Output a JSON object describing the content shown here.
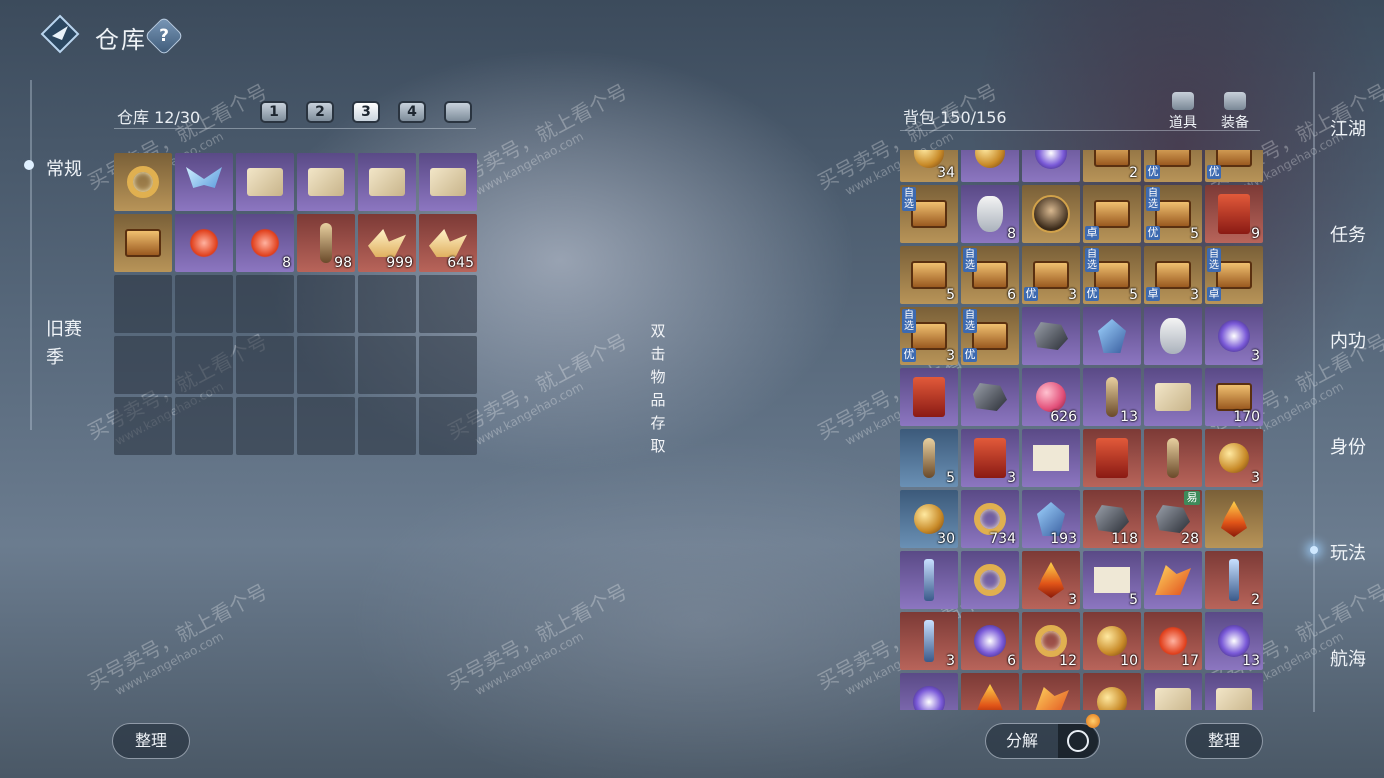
{
  "header": {
    "title": "仓库",
    "help_label": "?"
  },
  "left_nav": {
    "regular": "常规",
    "old_season": "旧赛季"
  },
  "warehouse": {
    "label": "仓库",
    "capacity": "12/30",
    "pages": [
      "1",
      "2",
      "3",
      "4",
      ""
    ],
    "active_page": "3",
    "items": [
      {
        "rarity": "gold",
        "icon": "ring",
        "count": ""
      },
      {
        "rarity": "purple",
        "icon": "butterfly",
        "count": ""
      },
      {
        "rarity": "purple",
        "icon": "scroll",
        "count": ""
      },
      {
        "rarity": "purple",
        "icon": "scroll",
        "count": ""
      },
      {
        "rarity": "purple",
        "icon": "scroll",
        "count": ""
      },
      {
        "rarity": "purple",
        "icon": "scroll",
        "count": ""
      },
      {
        "rarity": "gold",
        "icon": "box",
        "count": ""
      },
      {
        "rarity": "purple",
        "icon": "flower",
        "count": ""
      },
      {
        "rarity": "purple",
        "icon": "flower",
        "count": "8"
      },
      {
        "rarity": "red",
        "icon": "feather",
        "count": "98"
      },
      {
        "rarity": "red",
        "icon": "bird",
        "count": "999"
      },
      {
        "rarity": "red",
        "icon": "bird",
        "count": "645"
      },
      {},
      {},
      {},
      {},
      {},
      {},
      {},
      {},
      {},
      {},
      {},
      {},
      {},
      {},
      {},
      {},
      {},
      {}
    ]
  },
  "hint": "双击物品存取",
  "backpack": {
    "label": "背包",
    "capacity": "150/156",
    "tabs": [
      "道具",
      "装备"
    ],
    "items": [
      {
        "rarity": "gold",
        "icon": "orb",
        "count": "34"
      },
      {
        "rarity": "purple",
        "icon": "orb",
        "count": ""
      },
      {
        "rarity": "purple",
        "icon": "sigil",
        "count": ""
      },
      {
        "rarity": "gold",
        "icon": "box",
        "count": "2"
      },
      {
        "rarity": "gold",
        "icon": "box",
        "count": "",
        "tag2": "优"
      },
      {
        "rarity": "gold",
        "icon": "box",
        "count": "",
        "tag2": "优"
      },
      {
        "rarity": "gold",
        "icon": "box",
        "count": "",
        "tag": "自选"
      },
      {
        "rarity": "purple",
        "icon": "bottle",
        "count": "8"
      },
      {
        "rarity": "gold",
        "icon": "portrait",
        "count": ""
      },
      {
        "rarity": "gold",
        "icon": "box",
        "count": "",
        "tag2": "卓"
      },
      {
        "rarity": "gold",
        "icon": "box",
        "count": "5",
        "tag": "自选",
        "tag2": "优"
      },
      {
        "rarity": "red",
        "icon": "card",
        "count": "9"
      },
      {
        "rarity": "gold",
        "icon": "box",
        "count": "5"
      },
      {
        "rarity": "gold",
        "icon": "box",
        "count": "6",
        "tag": "自选"
      },
      {
        "rarity": "gold",
        "icon": "box",
        "count": "3",
        "tag2": "优"
      },
      {
        "rarity": "gold",
        "icon": "box",
        "count": "5",
        "tag": "自选",
        "tag2": "优"
      },
      {
        "rarity": "gold",
        "icon": "box",
        "count": "3",
        "tag2": "卓"
      },
      {
        "rarity": "gold",
        "icon": "box",
        "count": "",
        "tag": "自选",
        "tag2": "卓"
      },
      {
        "rarity": "gold",
        "icon": "box",
        "count": "3",
        "tag": "自选",
        "tag2": "优"
      },
      {
        "rarity": "gold",
        "icon": "box",
        "count": "",
        "tag": "自选",
        "tag2": "优"
      },
      {
        "rarity": "purple",
        "icon": "rock",
        "count": ""
      },
      {
        "rarity": "purple",
        "icon": "crystal",
        "count": ""
      },
      {
        "rarity": "purple",
        "icon": "bottle",
        "count": ""
      },
      {
        "rarity": "purple",
        "icon": "sigil",
        "count": "3"
      },
      {
        "rarity": "purple",
        "icon": "card",
        "count": ""
      },
      {
        "rarity": "purple",
        "icon": "rock",
        "count": ""
      },
      {
        "rarity": "purple",
        "icon": "pink",
        "count": "626"
      },
      {
        "rarity": "purple",
        "icon": "feather",
        "count": "13"
      },
      {
        "rarity": "purple",
        "icon": "scroll",
        "count": ""
      },
      {
        "rarity": "purple",
        "icon": "box",
        "count": "170"
      },
      {
        "rarity": "blue",
        "icon": "feather",
        "count": "5"
      },
      {
        "rarity": "purple",
        "icon": "card",
        "count": "3"
      },
      {
        "rarity": "purple",
        "icon": "paper",
        "count": ""
      },
      {
        "rarity": "red",
        "icon": "card",
        "count": ""
      },
      {
        "rarity": "red",
        "icon": "feather",
        "count": ""
      },
      {
        "rarity": "red",
        "icon": "orb",
        "count": "3"
      },
      {
        "rarity": "blue",
        "icon": "orb",
        "count": "30"
      },
      {
        "rarity": "purple",
        "icon": "ring",
        "count": "734"
      },
      {
        "rarity": "purple",
        "icon": "crystal",
        "count": "193"
      },
      {
        "rarity": "red",
        "icon": "rock",
        "count": "118"
      },
      {
        "rarity": "red",
        "icon": "rock",
        "count": "28",
        "tagr": "易"
      },
      {
        "rarity": "gold",
        "icon": "flame",
        "count": ""
      },
      {
        "rarity": "purple",
        "icon": "blade",
        "count": ""
      },
      {
        "rarity": "purple",
        "icon": "ring",
        "count": ""
      },
      {
        "rarity": "red",
        "icon": "flame",
        "count": "3"
      },
      {
        "rarity": "purple",
        "icon": "paper",
        "count": "5"
      },
      {
        "rarity": "purple",
        "icon": "wing",
        "count": ""
      },
      {
        "rarity": "red",
        "icon": "blade",
        "count": "2"
      },
      {
        "rarity": "red",
        "icon": "blade",
        "count": "3"
      },
      {
        "rarity": "red",
        "icon": "sigil",
        "count": "6"
      },
      {
        "rarity": "red",
        "icon": "ring",
        "count": "12"
      },
      {
        "rarity": "red",
        "icon": "orb",
        "count": "10"
      },
      {
        "rarity": "red",
        "icon": "flower",
        "count": "17"
      },
      {
        "rarity": "purple",
        "icon": "sigil",
        "count": "13"
      },
      {
        "rarity": "purple",
        "icon": "sigil",
        "count": ""
      },
      {
        "rarity": "red",
        "icon": "flame",
        "count": ""
      },
      {
        "rarity": "red",
        "icon": "wing",
        "count": ""
      },
      {
        "rarity": "red",
        "icon": "orb",
        "count": ""
      },
      {
        "rarity": "purple",
        "icon": "scroll",
        "count": ""
      },
      {
        "rarity": "purple",
        "icon": "scroll",
        "count": ""
      }
    ]
  },
  "right_nav": [
    "江湖",
    "任务",
    "内功",
    "身份",
    "玩法",
    "航海"
  ],
  "right_nav_active": "玩法",
  "buttons": {
    "sort_left": "整理",
    "decompose": "分解",
    "sort_right": "整理"
  },
  "watermark": {
    "text": "买号卖号，就上看个号",
    "url": "www.kangehao.com",
    "badge": "看个号"
  }
}
